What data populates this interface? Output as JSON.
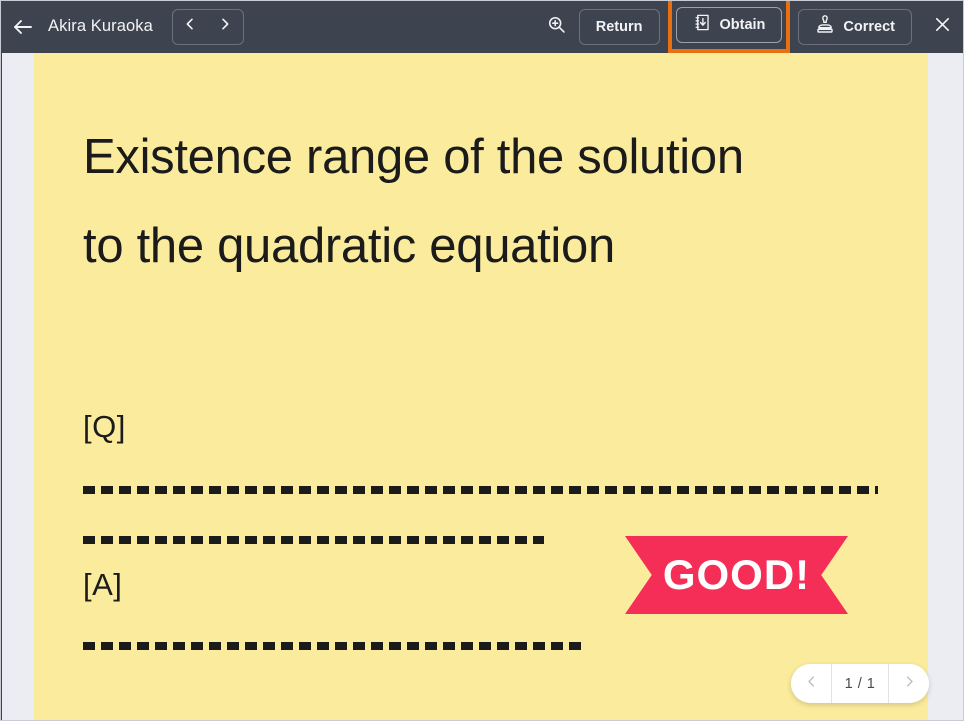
{
  "header": {
    "back_icon": "arrow-left-icon",
    "owner_name": "Akira Kuraoka",
    "prev_icon": "chevron-left-icon",
    "next_icon": "chevron-right-icon",
    "zoom_icon": "zoom-in-icon",
    "close_icon": "close-icon",
    "buttons": [
      {
        "label": "Return",
        "icon": "",
        "selected": false
      },
      {
        "label": "Obtain",
        "icon": "notebook-download-icon",
        "selected": true
      },
      {
        "label": "Correct",
        "icon": "stamp-icon",
        "selected": false
      }
    ],
    "highlight_color": "#e8700f",
    "background_color": "#3e4350"
  },
  "document": {
    "background_color": "#fbeb9c",
    "title": "Existence range of the solution to the quadratic equation",
    "question_label": "[Q]",
    "answer_label": "[A]",
    "dashed_lines": 3
  },
  "stamp": {
    "text": "GOOD!",
    "color": "#f52e57",
    "text_color": "#ffffff"
  },
  "pager": {
    "prev_icon": "chevron-left-icon",
    "next_icon": "chevron-right-icon",
    "count": "1 / 1"
  }
}
